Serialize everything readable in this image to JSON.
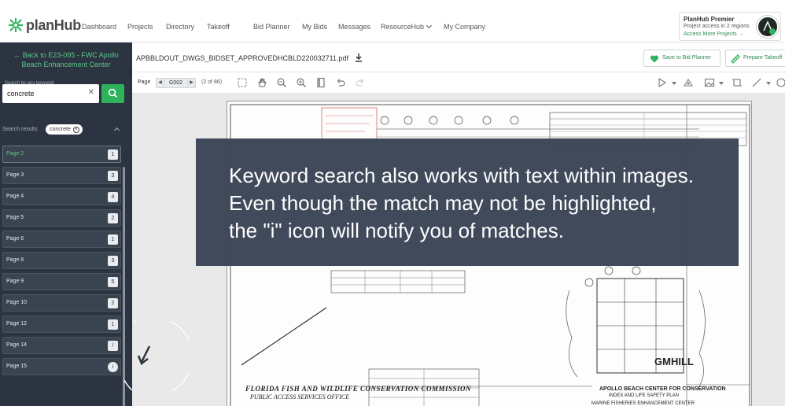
{
  "nav": {
    "logo_text": "planHub",
    "items": [
      {
        "label": "Dashboard"
      },
      {
        "label": "Projects"
      },
      {
        "label": "Directory"
      },
      {
        "label": "Takeoff"
      },
      {
        "label": "Bid Planner"
      },
      {
        "label": "My Bids"
      },
      {
        "label": "Messages"
      },
      {
        "label": "ResourceHub"
      },
      {
        "label": "My Company"
      }
    ],
    "premier": {
      "title": "PlanHub Premier",
      "subtitle": "Project access in 2 regions",
      "link": "Access More Projects →"
    }
  },
  "sidebar": {
    "back_link": "← Back to E23-095 - FWC Apollo Beach Enhancement Center",
    "search_label": "Search by any keyword",
    "search_value": "concrete",
    "results_label": "Search results",
    "chip_label": "concrete",
    "pages": [
      {
        "label": "Page 2",
        "count": "1",
        "active": true
      },
      {
        "label": "Page 3",
        "count": "3"
      },
      {
        "label": "Page 4",
        "count": "4"
      },
      {
        "label": "Page 5",
        "count": "2"
      },
      {
        "label": "Page 6",
        "count": "1"
      },
      {
        "label": "Page 8",
        "count": "3"
      },
      {
        "label": "Page 9",
        "count": "5"
      },
      {
        "label": "Page 10",
        "count": "2"
      },
      {
        "label": "Page 12",
        "count": "1"
      },
      {
        "label": "Page 14",
        "count": "/"
      },
      {
        "label": "Page 15",
        "count": "i"
      }
    ]
  },
  "doc": {
    "filename": "APBBLDOUT_DWGS_BIDSET_APPROVEDHCBLD220032711.pdf",
    "save_label": "Save to Bid Planner",
    "takeoff_label": "Prepare Takeoff",
    "page_label": "Page",
    "page_value": "G002",
    "page_of": "(2 of 86)"
  },
  "sheet": {
    "logo": "GMHILL",
    "title_line1": "FLORIDA FISH AND WILDLIFE CONSERVATION COMMISSION",
    "title_line2": "PUBLIC ACCESS SERVICES OFFICE",
    "block_title": "APOLLO BEACH CENTER FOR CONSERVATION",
    "block_sub": "INDEX AND LIFE SAFETY PLAN",
    "block_sub2": "MARINE FISHERIES ENHANCEMENT CENTER"
  },
  "caption": {
    "line1": "Keyword search also works with text within images.",
    "line2": "Even though the match may not be highlighted,",
    "line3": "the \"i\" icon will notify you of matches."
  },
  "colors": {
    "accent_green": "#2fb25c",
    "sidebar_bg": "#2b3440",
    "caption_bg": "#3b4556"
  }
}
